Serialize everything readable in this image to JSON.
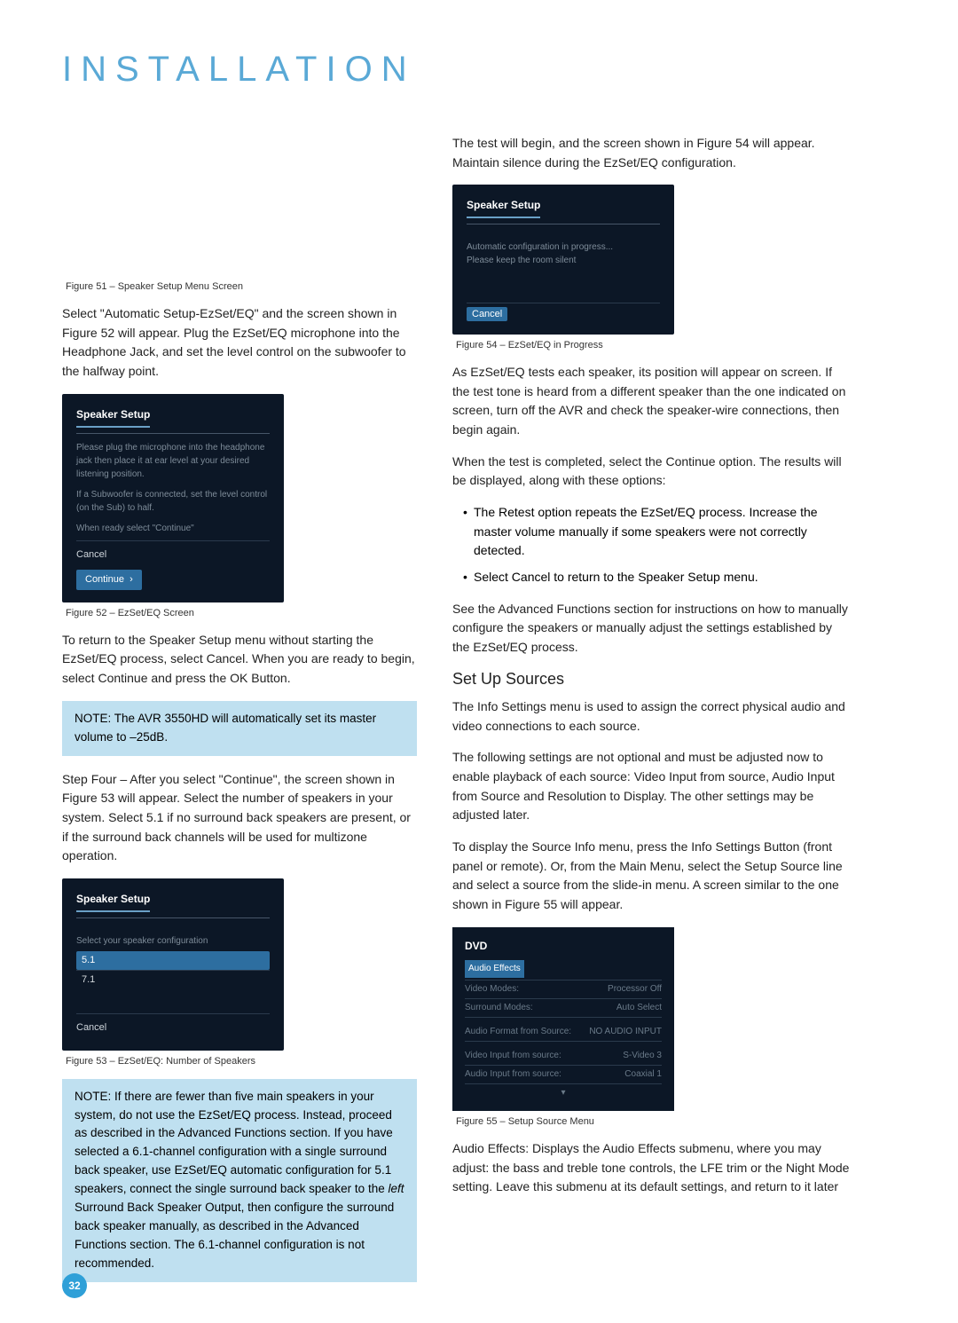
{
  "title": "INSTALLATION",
  "pagenum": "32",
  "left": {
    "fig51_caption": "Figure 51 – Speaker Setup Menu Screen",
    "p1": "Select \"Automatic Setup-EzSet/EQ\" and the screen shown in Figure 52 will appear. Plug the EzSet/EQ microphone into the Headphone Jack, and set the level control on the subwoofer to the halfway point.",
    "fig52": {
      "header": "Speaker Setup",
      "l1": "Please plug the microphone into the headphone jack then place it at ear level at your desired listening position.",
      "l2": "If a Subwoofer is connected, set the level control (on the Sub) to half.",
      "l3": "When ready select \"Continue\"",
      "cancel": "Cancel",
      "continue": "Continue"
    },
    "fig52_caption": "Figure 52 – EzSet/EQ Screen",
    "p2": "To return to the Speaker Setup menu without starting the EzSet/EQ process, select Cancel. When you are ready to begin, select Continue and press the OK Button.",
    "note1_lead": "NOTE:",
    "note1": " The AVR 3550HD will automatically set its master volume to –25dB.",
    "step4_lead": "Step Four –",
    "p3": " After you select \"Continue\", the screen shown in Figure 53 will appear. Select the number of speakers in your system. Select 5.1 if no surround back speakers are present, or if the surround back channels will be used for multizone operation.",
    "fig53": {
      "header": "Speaker Setup",
      "prompt": "Select your speaker configuration",
      "opt1": "5.1",
      "opt2": "7.1",
      "cancel": "Cancel"
    },
    "fig53_caption": "Figure 53 – EzSet/EQ: Number of Speakers",
    "note2_lead": "NOTE:",
    "note2a": " If there are fewer than five main speakers in your system, do not use the EzSet/EQ process. Instead, proceed as described in the Advanced Functions section. If you have selected a 6.1-channel configuration with a single surround back speaker, use EzSet/EQ automatic configuration for 5.1 speakers, connect the single surround back speaker to the ",
    "note2_left": "left",
    "note2b": " Surround Back Speaker Output, then configure the surround back speaker manually, as described in the Advanced Functions section. The 6.1-channel configuration is not recommended."
  },
  "right": {
    "p1": "The test will begin, and the screen shown in Figure 54 will appear. Maintain silence during the EzSet/EQ configuration.",
    "fig54": {
      "header": "Speaker Setup",
      "l1": "Automatic configuration in progress...",
      "l2": "Please keep the room silent",
      "cancel": "Cancel"
    },
    "fig54_caption": "Figure 54 – EzSet/EQ in Progress",
    "p2": "As EzSet/EQ tests each speaker, its position will appear on screen. If the test tone is heard from a different speaker than the one indicated on screen, turn off the AVR and check the speaker-wire connections, then begin again.",
    "p3": "When the test is completed, select the Continue option. The results will be displayed, along with these options:",
    "b1": "The Retest option repeats the EzSet/EQ process. Increase the master volume manually if some speakers were not correctly detected.",
    "b2": "Select Cancel to return to the Speaker Setup menu.",
    "p4": "See the Advanced Functions section for instructions on how to manually configure the speakers or manually adjust the settings established by the EzSet/EQ process.",
    "h2": "Set Up Sources",
    "p5": "The Info Settings menu is used to assign the correct physical audio and video connections to each source.",
    "p6": "The following settings are not optional and must be adjusted now to enable playback of each source: Video Input from source, Audio Input from Source and Resolution to Display. The other settings may be adjusted later.",
    "p7": "To display the Source Info menu, press the Info Settings Button (front panel or remote). Or, from the Main Menu, select the Setup Source line and select a source from the slide-in menu. A screen similar to the one shown in Figure 55 will appear.",
    "fig55": {
      "title": "DVD",
      "r1a": "Audio Effects",
      "r1b": "",
      "r2a": "Video Modes:",
      "r2b": "Processor Off",
      "r3a": "Surround Modes:",
      "r3b": "Auto Select",
      "r4a": "Audio Format from Source:",
      "r4b": "NO AUDIO INPUT",
      "r5a": "Video Input from source:",
      "r5b": "S-Video 3",
      "r6a": "Audio Input from source:",
      "r6b": "Coaxial 1"
    },
    "fig55_caption": "Figure 55 – Setup Source Menu",
    "p8_lead": "Audio Effects:",
    "p8": " Displays the Audio Effects submenu, where you may adjust: the bass and treble tone controls, the LFE trim or the Night Mode setting. Leave this submenu at its default settings, and return to it later"
  }
}
